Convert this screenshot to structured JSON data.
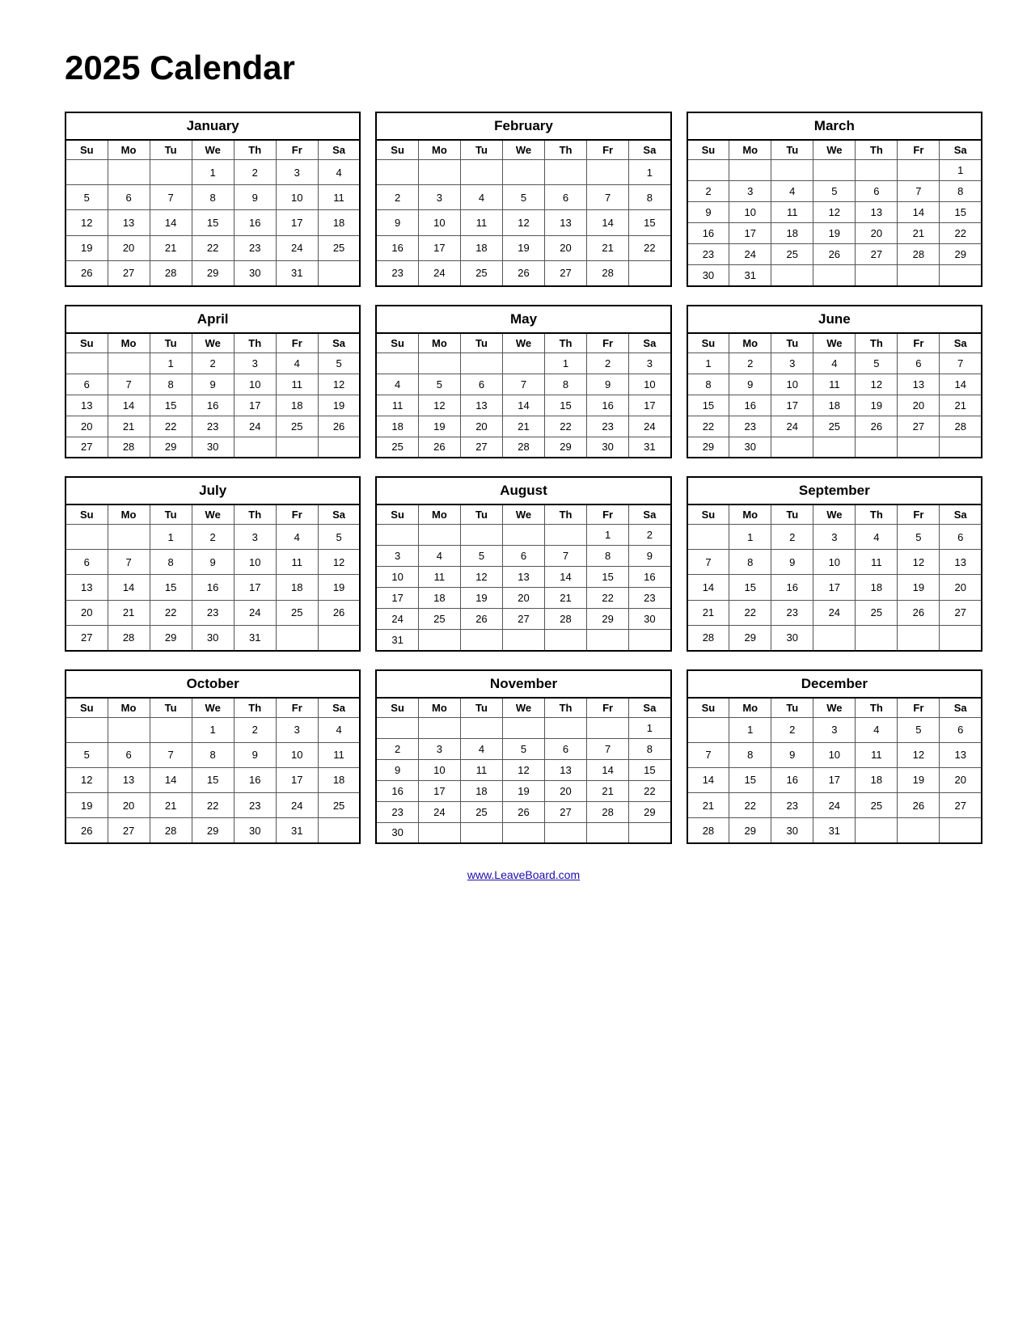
{
  "title": "2025 Calendar",
  "footer_link": "www.LeaveBoard.com",
  "days_header": [
    "Su",
    "Mo",
    "Tu",
    "We",
    "Th",
    "Fr",
    "Sa"
  ],
  "months": [
    {
      "name": "January",
      "weeks": [
        [
          "",
          "",
          "",
          "1",
          "2",
          "3",
          "4"
        ],
        [
          "5",
          "6",
          "7",
          "8",
          "9",
          "10",
          "11"
        ],
        [
          "12",
          "13",
          "14",
          "15",
          "16",
          "17",
          "18"
        ],
        [
          "19",
          "20",
          "21",
          "22",
          "23",
          "24",
          "25"
        ],
        [
          "26",
          "27",
          "28",
          "29",
          "30",
          "31",
          ""
        ]
      ]
    },
    {
      "name": "February",
      "weeks": [
        [
          "",
          "",
          "",
          "",
          "",
          "",
          "1"
        ],
        [
          "2",
          "3",
          "4",
          "5",
          "6",
          "7",
          "8"
        ],
        [
          "9",
          "10",
          "11",
          "12",
          "13",
          "14",
          "15"
        ],
        [
          "16",
          "17",
          "18",
          "19",
          "20",
          "21",
          "22"
        ],
        [
          "23",
          "24",
          "25",
          "26",
          "27",
          "28",
          ""
        ]
      ]
    },
    {
      "name": "March",
      "weeks": [
        [
          "",
          "",
          "",
          "",
          "",
          "",
          "1"
        ],
        [
          "2",
          "3",
          "4",
          "5",
          "6",
          "7",
          "8"
        ],
        [
          "9",
          "10",
          "11",
          "12",
          "13",
          "14",
          "15"
        ],
        [
          "16",
          "17",
          "18",
          "19",
          "20",
          "21",
          "22"
        ],
        [
          "23",
          "24",
          "25",
          "26",
          "27",
          "28",
          "29"
        ],
        [
          "30",
          "31",
          "",
          "",
          "",
          "",
          ""
        ]
      ]
    },
    {
      "name": "April",
      "weeks": [
        [
          "",
          "",
          "1",
          "2",
          "3",
          "4",
          "5"
        ],
        [
          "6",
          "7",
          "8",
          "9",
          "10",
          "11",
          "12"
        ],
        [
          "13",
          "14",
          "15",
          "16",
          "17",
          "18",
          "19"
        ],
        [
          "20",
          "21",
          "22",
          "23",
          "24",
          "25",
          "26"
        ],
        [
          "27",
          "28",
          "29",
          "30",
          "",
          "",
          ""
        ]
      ]
    },
    {
      "name": "May",
      "weeks": [
        [
          "",
          "",
          "",
          "",
          "1",
          "2",
          "3"
        ],
        [
          "4",
          "5",
          "6",
          "7",
          "8",
          "9",
          "10"
        ],
        [
          "11",
          "12",
          "13",
          "14",
          "15",
          "16",
          "17"
        ],
        [
          "18",
          "19",
          "20",
          "21",
          "22",
          "23",
          "24"
        ],
        [
          "25",
          "26",
          "27",
          "28",
          "29",
          "30",
          "31"
        ]
      ]
    },
    {
      "name": "June",
      "weeks": [
        [
          "1",
          "2",
          "3",
          "4",
          "5",
          "6",
          "7"
        ],
        [
          "8",
          "9",
          "10",
          "11",
          "12",
          "13",
          "14"
        ],
        [
          "15",
          "16",
          "17",
          "18",
          "19",
          "20",
          "21"
        ],
        [
          "22",
          "23",
          "24",
          "25",
          "26",
          "27",
          "28"
        ],
        [
          "29",
          "30",
          "",
          "",
          "",
          "",
          ""
        ]
      ]
    },
    {
      "name": "July",
      "weeks": [
        [
          "",
          "",
          "1",
          "2",
          "3",
          "4",
          "5"
        ],
        [
          "6",
          "7",
          "8",
          "9",
          "10",
          "11",
          "12"
        ],
        [
          "13",
          "14",
          "15",
          "16",
          "17",
          "18",
          "19"
        ],
        [
          "20",
          "21",
          "22",
          "23",
          "24",
          "25",
          "26"
        ],
        [
          "27",
          "28",
          "29",
          "30",
          "31",
          "",
          ""
        ]
      ]
    },
    {
      "name": "August",
      "weeks": [
        [
          "",
          "",
          "",
          "",
          "",
          "1",
          "2"
        ],
        [
          "3",
          "4",
          "5",
          "6",
          "7",
          "8",
          "9"
        ],
        [
          "10",
          "11",
          "12",
          "13",
          "14",
          "15",
          "16"
        ],
        [
          "17",
          "18",
          "19",
          "20",
          "21",
          "22",
          "23"
        ],
        [
          "24",
          "25",
          "26",
          "27",
          "28",
          "29",
          "30"
        ],
        [
          "31",
          "",
          "",
          "",
          "",
          "",
          ""
        ]
      ]
    },
    {
      "name": "September",
      "weeks": [
        [
          "",
          "1",
          "2",
          "3",
          "4",
          "5",
          "6"
        ],
        [
          "7",
          "8",
          "9",
          "10",
          "11",
          "12",
          "13"
        ],
        [
          "14",
          "15",
          "16",
          "17",
          "18",
          "19",
          "20"
        ],
        [
          "21",
          "22",
          "23",
          "24",
          "25",
          "26",
          "27"
        ],
        [
          "28",
          "29",
          "30",
          "",
          "",
          "",
          ""
        ]
      ]
    },
    {
      "name": "October",
      "weeks": [
        [
          "",
          "",
          "",
          "1",
          "2",
          "3",
          "4"
        ],
        [
          "5",
          "6",
          "7",
          "8",
          "9",
          "10",
          "11"
        ],
        [
          "12",
          "13",
          "14",
          "15",
          "16",
          "17",
          "18"
        ],
        [
          "19",
          "20",
          "21",
          "22",
          "23",
          "24",
          "25"
        ],
        [
          "26",
          "27",
          "28",
          "29",
          "30",
          "31",
          ""
        ]
      ]
    },
    {
      "name": "November",
      "weeks": [
        [
          "",
          "",
          "",
          "",
          "",
          "",
          "1"
        ],
        [
          "2",
          "3",
          "4",
          "5",
          "6",
          "7",
          "8"
        ],
        [
          "9",
          "10",
          "11",
          "12",
          "13",
          "14",
          "15"
        ],
        [
          "16",
          "17",
          "18",
          "19",
          "20",
          "21",
          "22"
        ],
        [
          "23",
          "24",
          "25",
          "26",
          "27",
          "28",
          "29"
        ],
        [
          "30",
          "",
          "",
          "",
          "",
          "",
          ""
        ]
      ]
    },
    {
      "name": "December",
      "weeks": [
        [
          "",
          "1",
          "2",
          "3",
          "4",
          "5",
          "6"
        ],
        [
          "7",
          "8",
          "9",
          "10",
          "11",
          "12",
          "13"
        ],
        [
          "14",
          "15",
          "16",
          "17",
          "18",
          "19",
          "20"
        ],
        [
          "21",
          "22",
          "23",
          "24",
          "25",
          "26",
          "27"
        ],
        [
          "28",
          "29",
          "30",
          "31",
          "",
          "",
          ""
        ]
      ]
    }
  ]
}
